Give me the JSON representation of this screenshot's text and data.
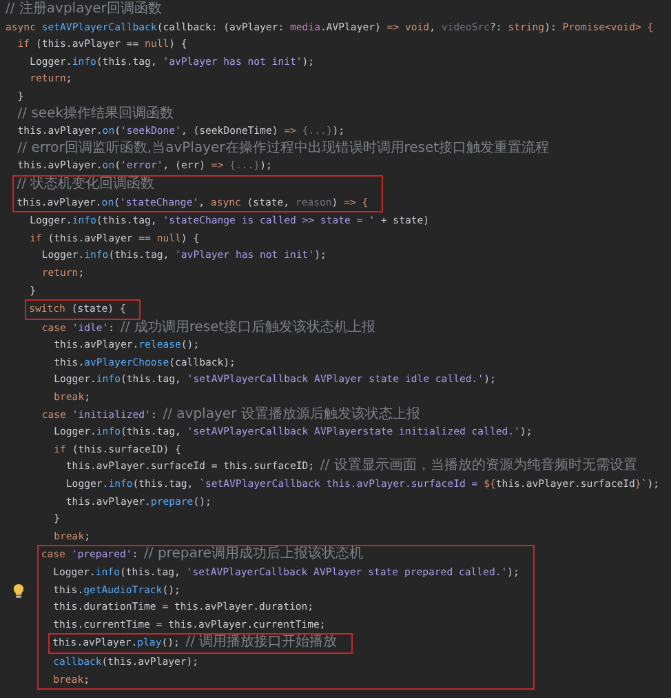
{
  "lines": [
    {
      "kind": "line",
      "tokens": [
        {
          "text": "// 注册avplayer回调函数",
          "kind": "cm"
        }
      ]
    },
    {
      "kind": "line",
      "tokens": [
        {
          "text": "async ",
          "kind": "kw"
        },
        {
          "text": "setAVPlayerCallback",
          "kind": "fn"
        },
        {
          "text": "(callback: (avPlayer: ",
          "kind": "pl"
        },
        {
          "text": "media",
          "kind": "type"
        },
        {
          "text": ".AVPlayer) ",
          "kind": "pl"
        },
        {
          "text": "=> void",
          "kind": "kw"
        },
        {
          "text": ", ",
          "kind": "pl"
        },
        {
          "text": "videoSrc",
          "kind": "dim"
        },
        {
          "text": "?: ",
          "kind": "pl"
        },
        {
          "text": "string",
          "kind": "kw"
        },
        {
          "text": "): ",
          "kind": "pl"
        },
        {
          "text": "Promise<void> {",
          "kind": "kw"
        }
      ],
      "children": [
        {
          "kind": "line",
          "tokens": [
            {
              "text": "if ",
              "kind": "kw"
            },
            {
              "text": "(this.avPlayer == ",
              "kind": "pl"
            },
            {
              "text": "null",
              "kind": "kw"
            },
            {
              "text": ") {",
              "kind": "pl"
            }
          ],
          "children": [
            {
              "kind": "line",
              "tokens": [
                {
                  "text": "Logger.",
                  "kind": "pl"
                },
                {
                  "text": "info",
                  "kind": "fn"
                },
                {
                  "text": "(this.tag, ",
                  "kind": "pl"
                },
                {
                  "text": "'avPlayer has not init'",
                  "kind": "str"
                },
                {
                  "text": ");",
                  "kind": "pl"
                }
              ]
            },
            {
              "kind": "line",
              "tokens": [
                {
                  "text": "return",
                  "kind": "kw"
                },
                {
                  "text": ";",
                  "kind": "pl"
                }
              ]
            }
          ]
        },
        {
          "kind": "line",
          "tokens": [
            {
              "text": "}",
              "kind": "pl"
            }
          ]
        },
        {
          "kind": "line",
          "tokens": [
            {
              "text": "// seek操作结果回调函数",
              "kind": "cm"
            }
          ]
        },
        {
          "kind": "line",
          "tokens": [
            {
              "text": "this.avPlayer.",
              "kind": "pl"
            },
            {
              "text": "on",
              "kind": "fn"
            },
            {
              "text": "(",
              "kind": "pl"
            },
            {
              "text": "'seekDone'",
              "kind": "str"
            },
            {
              "text": ", (seekDoneTime) ",
              "kind": "pl"
            },
            {
              "text": "=>",
              "kind": "kw"
            },
            {
              "text": " {...}",
              "kind": "dim"
            },
            {
              "text": ");",
              "kind": "pl"
            }
          ]
        },
        {
          "kind": "line",
          "tokens": [
            {
              "text": "// error回调监听函数,当avPlayer在操作过程中出现错误时调用reset接口触发重置流程",
              "kind": "cm"
            }
          ]
        },
        {
          "kind": "line",
          "tokens": [
            {
              "text": "this.avPlayer.",
              "kind": "pl"
            },
            {
              "text": "on",
              "kind": "fn"
            },
            {
              "text": "(",
              "kind": "pl"
            },
            {
              "text": "'error'",
              "kind": "str"
            },
            {
              "text": ", (err) ",
              "kind": "pl"
            },
            {
              "text": "=>",
              "kind": "kw"
            },
            {
              "text": " {...}",
              "kind": "dim"
            },
            {
              "text": ");",
              "kind": "pl"
            }
          ]
        },
        {
          "kind": "box",
          "lines": [
            {
              "kind": "line",
              "tokens": [
                {
                  "text": "// 状态机变化回调函数",
                  "kind": "cm"
                }
              ]
            },
            {
              "kind": "line",
              "tokens": [
                {
                  "text": "this.avPlayer.",
                  "kind": "pl"
                },
                {
                  "text": "on",
                  "kind": "fn"
                },
                {
                  "text": "(",
                  "kind": "pl"
                },
                {
                  "text": "'stateChange'",
                  "kind": "str"
                },
                {
                  "text": ", ",
                  "kind": "pl"
                },
                {
                  "text": "async",
                  "kind": "kw"
                },
                {
                  "text": " (state, ",
                  "kind": "pl"
                },
                {
                  "text": "reason",
                  "kind": "dim"
                },
                {
                  "text": ") ",
                  "kind": "pl"
                },
                {
                  "text": "=> {",
                  "kind": "kw"
                }
              ]
            }
          ]
        },
        {
          "kind": "group",
          "children": [
            {
              "kind": "line",
              "tokens": [
                {
                  "text": "Logger.",
                  "kind": "pl"
                },
                {
                  "text": "info",
                  "kind": "fn"
                },
                {
                  "text": "(this.tag, ",
                  "kind": "pl"
                },
                {
                  "text": "'stateChange is called >> state = '",
                  "kind": "str"
                },
                {
                  "text": " + state)",
                  "kind": "pl"
                }
              ]
            },
            {
              "kind": "line",
              "tokens": [
                {
                  "text": "if ",
                  "kind": "kw"
                },
                {
                  "text": "(this.avPlayer == ",
                  "kind": "pl"
                },
                {
                  "text": "null",
                  "kind": "kw"
                },
                {
                  "text": ") {",
                  "kind": "pl"
                }
              ],
              "children": [
                {
                  "kind": "line",
                  "tokens": [
                    {
                      "text": "Logger.",
                      "kind": "pl"
                    },
                    {
                      "text": "info",
                      "kind": "fn"
                    },
                    {
                      "text": "(this.tag, ",
                      "kind": "pl"
                    },
                    {
                      "text": "'avPlayer has not init'",
                      "kind": "str"
                    },
                    {
                      "text": ");",
                      "kind": "pl"
                    }
                  ]
                },
                {
                  "kind": "line",
                  "tokens": [
                    {
                      "text": "return",
                      "kind": "kw"
                    },
                    {
                      "text": ";",
                      "kind": "pl"
                    }
                  ]
                }
              ]
            },
            {
              "kind": "line",
              "tokens": [
                {
                  "text": "}",
                  "kind": "pl"
                }
              ]
            },
            {
              "kind": "box",
              "lines": [
                {
                  "kind": "line",
                  "tokens": [
                    {
                      "text": "switch",
                      "kind": "kw"
                    },
                    {
                      "text": " (state) {",
                      "kind": "pl"
                    }
                  ]
                }
              ]
            },
            {
              "kind": "group",
              "children": [
                {
                  "kind": "line",
                  "tokens": [
                    {
                      "text": "case ",
                      "kind": "kw"
                    },
                    {
                      "text": "'idle'",
                      "kind": "str"
                    },
                    {
                      "text": ": ",
                      "kind": "pl"
                    },
                    {
                      "text": "// 成功调用reset接口后触发该状态机上报",
                      "kind": "cm"
                    }
                  ],
                  "children": [
                    {
                      "kind": "line",
                      "tokens": [
                        {
                          "text": "this.avPlayer.",
                          "kind": "pl"
                        },
                        {
                          "text": "release",
                          "kind": "fn"
                        },
                        {
                          "text": "();",
                          "kind": "pl"
                        }
                      ]
                    },
                    {
                      "kind": "line",
                      "tokens": [
                        {
                          "text": "this.",
                          "kind": "pl"
                        },
                        {
                          "text": "avPlayerChoose",
                          "kind": "fn"
                        },
                        {
                          "text": "(callback);",
                          "kind": "pl"
                        }
                      ]
                    },
                    {
                      "kind": "line",
                      "tokens": [
                        {
                          "text": "Logger.",
                          "kind": "pl"
                        },
                        {
                          "text": "info",
                          "kind": "fn"
                        },
                        {
                          "text": "(this.tag, ",
                          "kind": "pl"
                        },
                        {
                          "text": "'setAVPlayerCallback AVPlayer state idle called.'",
                          "kind": "str"
                        },
                        {
                          "text": ");",
                          "kind": "pl"
                        }
                      ]
                    },
                    {
                      "kind": "line",
                      "tokens": [
                        {
                          "text": "break",
                          "kind": "kw"
                        },
                        {
                          "text": ";",
                          "kind": "pl"
                        }
                      ]
                    }
                  ]
                },
                {
                  "kind": "line",
                  "tokens": [
                    {
                      "text": "case ",
                      "kind": "kw"
                    },
                    {
                      "text": "'initialized'",
                      "kind": "str"
                    },
                    {
                      "text": ": ",
                      "kind": "pl"
                    },
                    {
                      "text": "// avplayer 设置播放源后触发该状态上报",
                      "kind": "cm"
                    }
                  ],
                  "children": [
                    {
                      "kind": "line",
                      "tokens": [
                        {
                          "text": "Logger.",
                          "kind": "pl"
                        },
                        {
                          "text": "info",
                          "kind": "fn"
                        },
                        {
                          "text": "(this.tag, ",
                          "kind": "pl"
                        },
                        {
                          "text": "'setAVPlayerCallback AVPlayerstate initialized called.'",
                          "kind": "str"
                        },
                        {
                          "text": ");",
                          "kind": "pl"
                        }
                      ]
                    },
                    {
                      "kind": "line",
                      "tokens": [
                        {
                          "text": "if",
                          "kind": "kw"
                        },
                        {
                          "text": " (this.surfaceID) {",
                          "kind": "pl"
                        }
                      ],
                      "children": [
                        {
                          "kind": "line",
                          "tokens": [
                            {
                              "text": "this.avPlayer.surfaceId = this.surfaceID; ",
                              "kind": "pl"
                            },
                            {
                              "text": "// 设置显示画面，当播放的资源为纯音频时无需设置",
                              "kind": "cm"
                            }
                          ]
                        },
                        {
                          "kind": "line",
                          "tokens": [
                            {
                              "text": "Logger.",
                              "kind": "pl"
                            },
                            {
                              "text": "info",
                              "kind": "fn"
                            },
                            {
                              "text": "(this.tag, ",
                              "kind": "pl"
                            },
                            {
                              "text": "`setAVPlayerCallback this.avPlayer.surfaceId = ",
                              "kind": "str"
                            },
                            {
                              "text": "${",
                              "kind": "kw"
                            },
                            {
                              "text": "this.avPlayer.surfaceId",
                              "kind": "pl"
                            },
                            {
                              "text": "}",
                              "kind": "kw"
                            },
                            {
                              "text": "`",
                              "kind": "str"
                            },
                            {
                              "text": ");",
                              "kind": "pl"
                            }
                          ]
                        },
                        {
                          "kind": "line",
                          "tokens": [
                            {
                              "text": "this.avPlayer.",
                              "kind": "pl"
                            },
                            {
                              "text": "prepare",
                              "kind": "fn"
                            },
                            {
                              "text": "();",
                              "kind": "pl"
                            }
                          ]
                        }
                      ]
                    },
                    {
                      "kind": "line",
                      "tokens": [
                        {
                          "text": "}",
                          "kind": "pl"
                        }
                      ]
                    },
                    {
                      "kind": "line",
                      "tokens": [
                        {
                          "text": "break",
                          "kind": "kw"
                        },
                        {
                          "text": ";",
                          "kind": "pl"
                        }
                      ]
                    }
                  ]
                },
                {
                  "kind": "box",
                  "lines": [
                    {
                      "kind": "line",
                      "tokens": [
                        {
                          "text": "case ",
                          "kind": "kw"
                        },
                        {
                          "text": "'prepared'",
                          "kind": "str"
                        },
                        {
                          "text": ": ",
                          "kind": "pl"
                        },
                        {
                          "text": "// prepare调用成功后上报该状态机",
                          "kind": "cm"
                        }
                      ],
                      "children": [
                        {
                          "kind": "line",
                          "tokens": [
                            {
                              "text": "Logger.",
                              "kind": "pl"
                            },
                            {
                              "text": "info",
                              "kind": "fn"
                            },
                            {
                              "text": "(this.tag, ",
                              "kind": "pl"
                            },
                            {
                              "text": "'setAVPlayerCallback AVPlayer state prepared called.'",
                              "kind": "str"
                            },
                            {
                              "text": ");",
                              "kind": "pl"
                            }
                          ]
                        },
                        {
                          "kind": "line",
                          "bulb": true,
                          "tokens": [
                            {
                              "text": "this.",
                              "kind": "pl"
                            },
                            {
                              "text": "getAudioTrack",
                              "kind": "fn"
                            },
                            {
                              "text": "();",
                              "kind": "pl"
                            }
                          ]
                        },
                        {
                          "kind": "line",
                          "tokens": [
                            {
                              "text": "this.durationTime = this.avPlayer.duration;",
                              "kind": "pl"
                            }
                          ]
                        },
                        {
                          "kind": "line",
                          "tokens": [
                            {
                              "text": "this.currentTime = this.avPlayer.currentTime;",
                              "kind": "pl"
                            }
                          ]
                        },
                        {
                          "kind": "box",
                          "lines": [
                            {
                              "kind": "line",
                              "tokens": [
                                {
                                  "text": "this.avPlayer.",
                                  "kind": "pl"
                                },
                                {
                                  "text": "play",
                                  "kind": "fn"
                                },
                                {
                                  "text": "(); ",
                                  "kind": "pl"
                                },
                                {
                                  "text": "// 调用播放接口开始播放",
                                  "kind": "cm"
                                }
                              ]
                            }
                          ]
                        },
                        {
                          "kind": "line",
                          "tokens": [
                            {
                              "text": "callback",
                              "kind": "fn"
                            },
                            {
                              "text": "(this.avPlayer);",
                              "kind": "pl"
                            }
                          ]
                        },
                        {
                          "kind": "line",
                          "tokens": [
                            {
                              "text": "break",
                              "kind": "kw"
                            },
                            {
                              "text": ";",
                              "kind": "pl"
                            }
                          ]
                        }
                      ]
                    }
                  ]
                }
              ]
            }
          ]
        }
      ]
    }
  ]
}
